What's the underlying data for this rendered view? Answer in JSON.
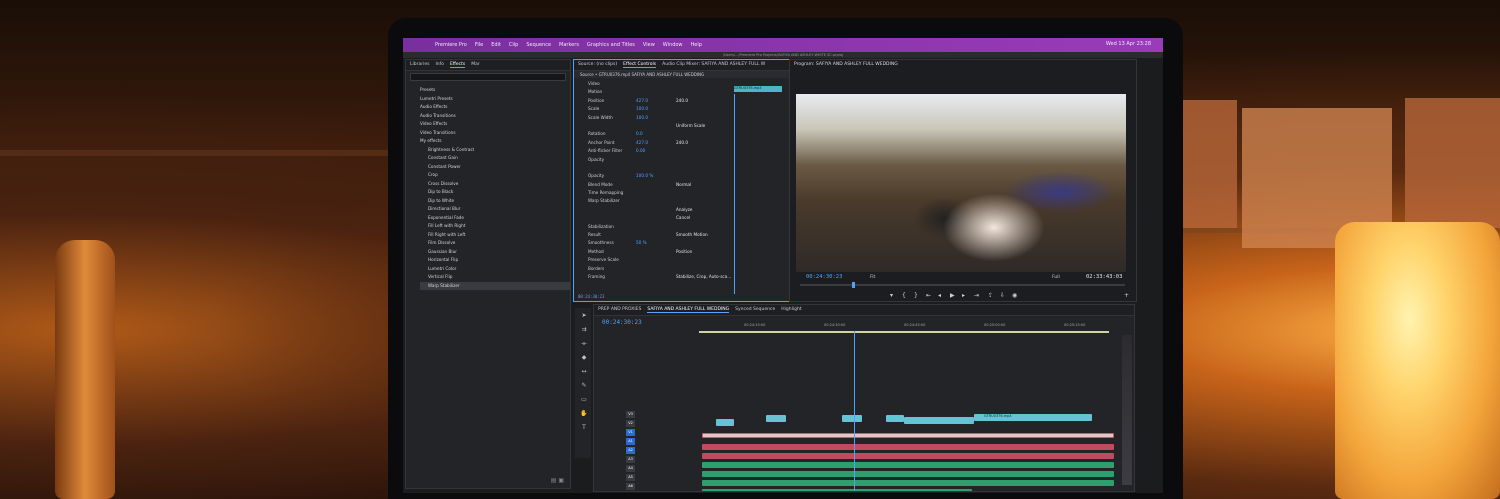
{
  "menubar": {
    "items": [
      "Premiere Pro",
      "File",
      "Edit",
      "Clip",
      "Sequence",
      "Markers",
      "Graphics and Titles",
      "View",
      "Window",
      "Help"
    ],
    "title_path": "/Users/.../Premiere Pro Projects/SAFIYA AND ASHLEY WHITE SC.prproj",
    "clock": "Wed 13 Apr  23:28"
  },
  "left_panel": {
    "tabs": [
      "Libraries",
      "Info",
      "Effects",
      "Mar"
    ],
    "active_tab": "Effects",
    "effects": [
      "Presets",
      "Lumetri Presets",
      "Audio Effects",
      "Audio Transitions",
      "Video Effects",
      "Video Transitions",
      "My effects",
      "Brightness & Contrast",
      "Constant Gain",
      "Constant Power",
      "Crop",
      "Cross Dissolve",
      "Dip to Black",
      "Dip to White",
      "Directional Blur",
      "Exponential Fade",
      "Fill Left with Right",
      "Fill Right with Left",
      "Film Dissolve",
      "Gaussian Blur",
      "Horizontal Flip",
      "Lumetri Color",
      "Vertical Flip",
      "Warp Stabilizer"
    ],
    "selected": "Warp Stabilizer"
  },
  "effect_controls": {
    "tabs": [
      "Source: (no clips)",
      "Effect Controls",
      "Audio Clip Mixer: SAFIYA AND ASHLEY FULL W"
    ],
    "active_tab": "Effect Controls",
    "source_line": "Source • GTRU0376.mp4    SAFIYA AND ASHLEY FULL WEDDING",
    "clip_name": "GTRU0376.mp4",
    "timecode": "00:24:30:23",
    "rows": [
      {
        "name": "Video",
        "v1": "",
        "v2": ""
      },
      {
        "name": "Motion",
        "v1": "",
        "v2": ""
      },
      {
        "name": "Position",
        "v1": "427.0",
        "v2": "240.0"
      },
      {
        "name": "Scale",
        "v1": "100.0",
        "v2": ""
      },
      {
        "name": "Scale Width",
        "v1": "100.0",
        "v2": ""
      },
      {
        "name": "",
        "v1": "",
        "v2": "Uniform Scale"
      },
      {
        "name": "Rotation",
        "v1": "0.0",
        "v2": ""
      },
      {
        "name": "Anchor Point",
        "v1": "427.0",
        "v2": "240.0"
      },
      {
        "name": "Anti-flicker Filter",
        "v1": "0.00",
        "v2": ""
      },
      {
        "name": "Opacity",
        "v1": "",
        "v2": ""
      },
      {
        "name": "",
        "v1": "",
        "v2": ""
      },
      {
        "name": "Opacity",
        "v1": "100.0 %",
        "v2": ""
      },
      {
        "name": "Blend Mode",
        "v1": "",
        "v2": "Normal"
      },
      {
        "name": "Time Remapping",
        "v1": "",
        "v2": ""
      },
      {
        "name": "Warp Stabilizer",
        "v1": "",
        "v2": ""
      },
      {
        "name": "",
        "v1": "",
        "v2": "Analyze"
      },
      {
        "name": "",
        "v1": "",
        "v2": "Cancel"
      },
      {
        "name": "Stabilization",
        "v1": "",
        "v2": ""
      },
      {
        "name": "Result",
        "v1": "",
        "v2": "Smooth Motion"
      },
      {
        "name": "Smoothness",
        "v1": "50 %",
        "v2": ""
      },
      {
        "name": "Method",
        "v1": "",
        "v2": "Position"
      },
      {
        "name": "Preserve Scale",
        "v1": "",
        "v2": ""
      },
      {
        "name": "Borders",
        "v1": "",
        "v2": ""
      },
      {
        "name": "Framing",
        "v1": "",
        "v2": "Stabilize, Crop, Auto-sca..."
      }
    ]
  },
  "program": {
    "title": "Program: SAFIYA AND ASHLEY FULL WEDDING",
    "timecode_left": "00:24:30:23",
    "fit": "Fit",
    "quality": "Full",
    "timecode_right": "02:33:43:03"
  },
  "timeline": {
    "tabs": [
      "PREP AND PROXIES",
      "SAFIYA AND ASHLEY FULL WEDDING",
      "Synced Sequence",
      "Highlight"
    ],
    "active_tab": "SAFIYA AND ASHLEY FULL WEDDING",
    "timecode": "00:24:30:23",
    "ruler": [
      "00:24:15:00",
      "00:24:30:00",
      "00:24:45:00",
      "00:25:00:00",
      "00:25:15:00"
    ],
    "track_labels": [
      "V3",
      "V2",
      "V1",
      "A1",
      "A2",
      "A3",
      "A4",
      "A5",
      "A6"
    ],
    "clip_label": "GTRU0376.mp4"
  },
  "colors": {
    "accent": "#4fa3ff",
    "menubar": "#9a3bb8",
    "video_clip": "#66c3d6",
    "audio_red": "#c04a60",
    "audio_green": "#2f9f6e"
  }
}
